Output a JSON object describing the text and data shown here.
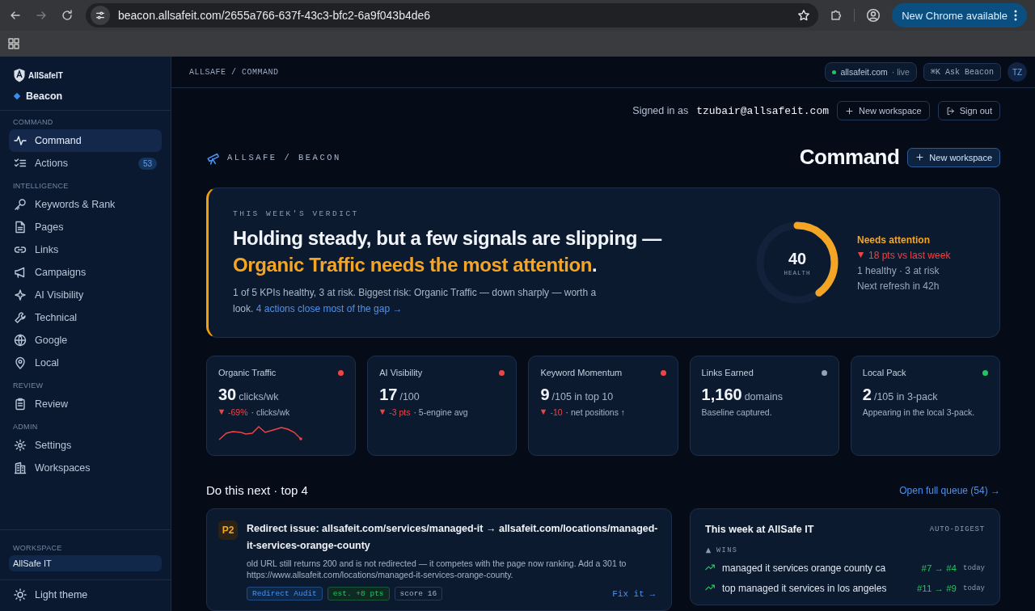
{
  "browser": {
    "url": "beacon.allsafeit.com/2655a766-637f-43c3-bfc2-6a9f043b4de6",
    "update_button": "New Chrome available"
  },
  "sidebar": {
    "logo": "AllSafeIT",
    "product": "Beacon",
    "sections": [
      {
        "label": "COMMAND",
        "items": [
          {
            "label": "Command",
            "selected": true
          },
          {
            "label": "Actions",
            "badge": "53",
            "selected": false
          }
        ]
      },
      {
        "label": "INTELLIGENCE",
        "items": [
          {
            "label": "Keywords & Rank",
            "selected": false
          },
          {
            "label": "Pages",
            "selected": false
          },
          {
            "label": "Links",
            "selected": false
          },
          {
            "label": "Campaigns",
            "selected": false
          },
          {
            "label": "AI Visibility",
            "selected": false
          },
          {
            "label": "Technical",
            "selected": false
          },
          {
            "label": "Google",
            "selected": false
          },
          {
            "label": "Local",
            "selected": false
          }
        ]
      },
      {
        "label": "REVIEW",
        "items": [
          {
            "label": "Review",
            "selected": false
          }
        ]
      },
      {
        "label": "ADMIN",
        "items": [
          {
            "label": "Settings",
            "selected": false
          },
          {
            "label": "Workspaces",
            "selected": false
          }
        ]
      }
    ],
    "workspace": {
      "label": "WORKSPACE",
      "name": "AllSafe IT"
    },
    "theme_toggle": "Light theme"
  },
  "header": {
    "breadcrumb": "ALLSAFE / COMMAND",
    "domain": "allsafeit.com",
    "domain_status": "· live",
    "ask": "⌘K Ask Beacon",
    "avatar": "TZ"
  },
  "account": {
    "prefix": "Signed in as",
    "email": "tzubair@allsafeit.com",
    "new_workspace": "New workspace",
    "sign_out": "Sign out"
  },
  "page": {
    "eyebrow": "ALLSAFE / BEACON",
    "title": "Command",
    "new_workspace": "New workspace"
  },
  "verdict": {
    "eyebrow": "THIS WEEK'S VERDICT",
    "headline": "Holding steady, but a few signals are slipping — *Organic Traffic needs the most attention*.",
    "summary": "1 of 5 KPIs healthy, 3 at risk. Biggest risk: Organic Traffic — down sharply — worth a look.",
    "link": "4 actions close most of the gap →",
    "gauge": {
      "value": "40",
      "label": "HEALTH",
      "level": 0.4
    },
    "status": "Needs attention",
    "delta": "18 pts vs last week",
    "counts": "1 healthy · 3 at risk",
    "refresh": "Next refresh in 42h"
  },
  "kpis": [
    {
      "kind": "sparkline",
      "name": "Organic Traffic",
      "color": "#ef4444",
      "value": "30",
      "unit": "clicks/wk",
      "delta": "-69%",
      "note": "· clicks/wk"
    },
    {
      "kind": "plain",
      "name": "AI Visibility",
      "color": "#ef4444",
      "value": "17",
      "unit": "/100",
      "delta": "-3 pts",
      "note": "· 5-engine avg"
    },
    {
      "kind": "plain",
      "name": "Keyword Momentum",
      "color": "#ef4444",
      "value": "9",
      "unit": "/105 in top 10",
      "delta": "-10",
      "note": "· net positions ↑"
    },
    {
      "kind": "plain",
      "name": "Links Earned",
      "color": "#94a3b8",
      "value": "1,160",
      "unit": "domains",
      "note": "Baseline captured."
    },
    {
      "kind": "plain",
      "name": "Local Pack",
      "color": "#22c55e",
      "value": "2",
      "unit": "/105 in 3-pack",
      "note": "Appearing in the local 3-pack."
    }
  ],
  "next": {
    "title": "Do this next · top 4",
    "queue_link": "Open full queue (54) →",
    "actions": [
      {
        "priority": "P2",
        "title": "Redirect issue: allsafeit.com/services/managed-it → allsafeit.com/locations/managed-it-services-orange-county",
        "description": "old URL still returns 200 and is not redirected — it competes with the page now ranking. Add a 301 to https://www.allsafeit.com/locations/managed-it-services-orange-county.",
        "tags": [
          {
            "kind": "source",
            "label": "Redirect Audit"
          },
          {
            "kind": "impact",
            "label": "est. +8 pts"
          },
          {
            "kind": "score",
            "label": "score 16"
          }
        ],
        "fix": "Fix it →"
      }
    ]
  },
  "digest": {
    "title": "This week at AllSafe IT",
    "tag": "AUTO-DIGEST",
    "wins_label": "WINS",
    "wins": [
      {
        "keyword": "managed it services orange county ca",
        "change": "#7 → #4",
        "when": "today"
      },
      {
        "keyword": "top managed it services in los angeles",
        "change": "#11 → #9",
        "when": "today"
      }
    ]
  }
}
